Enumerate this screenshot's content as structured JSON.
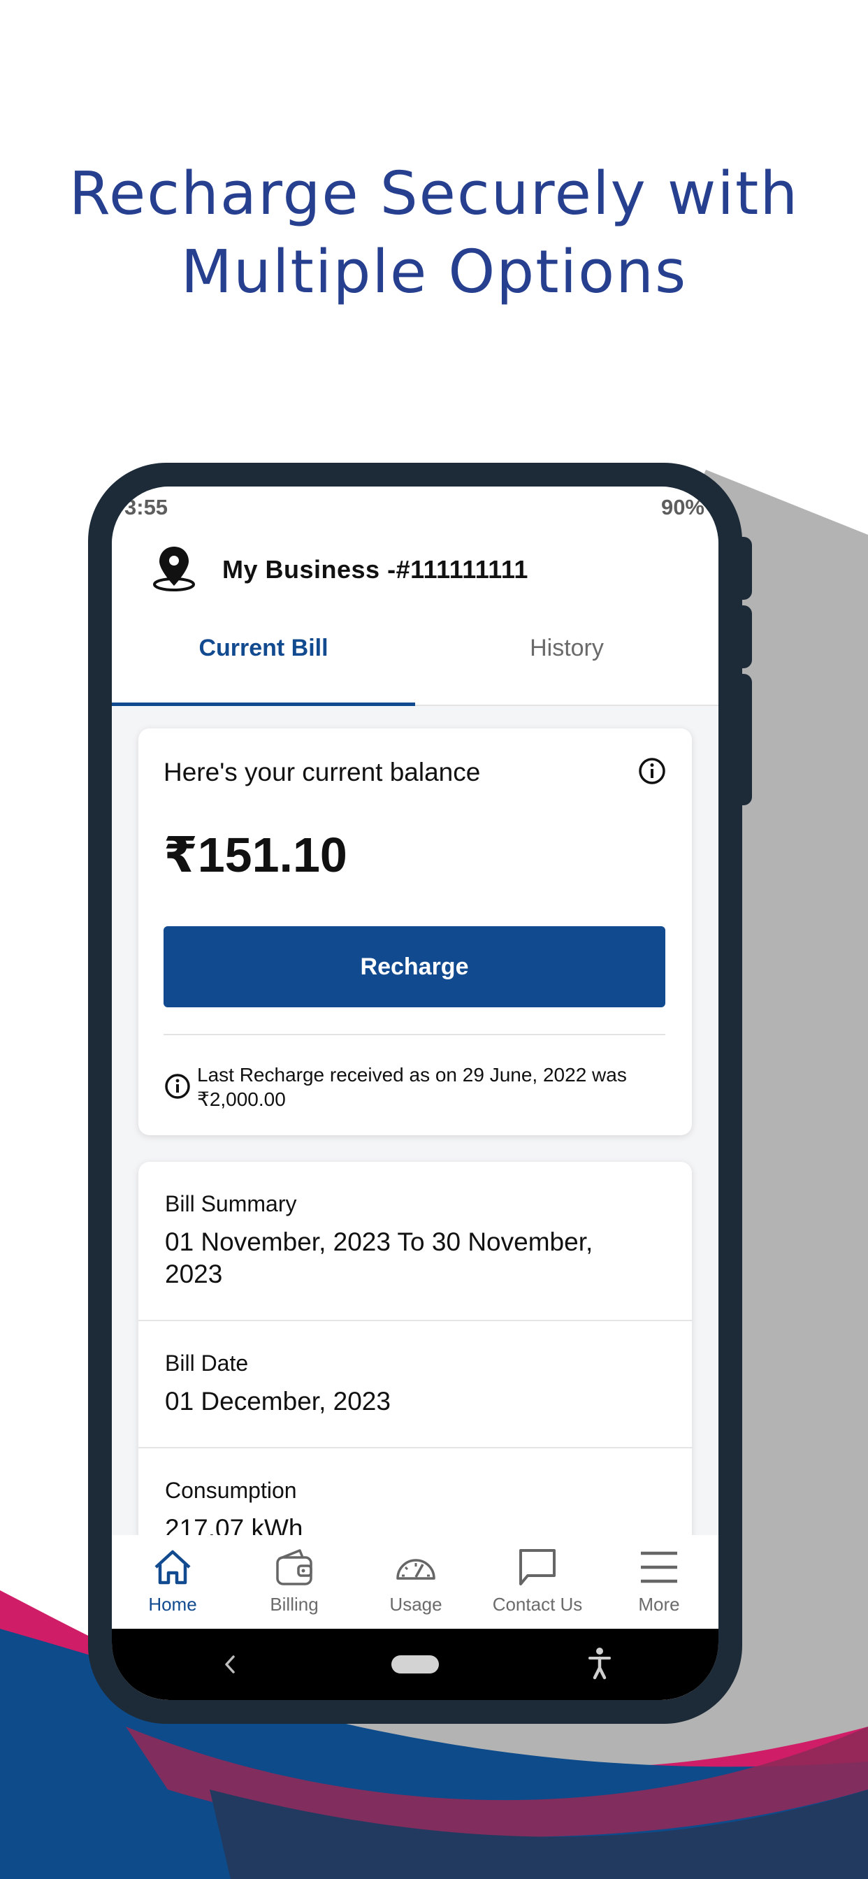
{
  "marketing": {
    "headline_line1": "Recharge Securely with",
    "headline_line2": "Multiple Options"
  },
  "status_bar": {
    "time": "3:55",
    "battery": "90%"
  },
  "header": {
    "account_title": "My Business -#111111111",
    "icon": "location-pin-icon"
  },
  "tabs": [
    {
      "label": "Current Bill",
      "active": true
    },
    {
      "label": "History",
      "active": false
    }
  ],
  "balance_card": {
    "label": "Here's your current balance",
    "amount": "₹151.10",
    "recharge_label": "Recharge",
    "last_recharge": "Last Recharge received as on 29 June, 2022 was ₹2,000.00"
  },
  "summary": {
    "rows": [
      {
        "label": "Bill Summary",
        "value": "01 November, 2023 To 30 November, 2023"
      },
      {
        "label": "Bill Date",
        "value": "01 December, 2023"
      },
      {
        "label": "Consumption",
        "value": "217.07 kWh"
      }
    ]
  },
  "bottom_nav": {
    "items": [
      {
        "label": "Home",
        "icon": "home-icon",
        "active": true
      },
      {
        "label": "Billing",
        "icon": "wallet-icon",
        "active": false
      },
      {
        "label": "Usage",
        "icon": "speedometer-icon",
        "active": false
      },
      {
        "label": "Contact Us",
        "icon": "chat-bubble-icon",
        "active": false
      },
      {
        "label": "More",
        "icon": "menu-icon",
        "active": false
      }
    ]
  },
  "colors": {
    "brand_blue": "#124a8f",
    "headline_blue": "#263f8f",
    "phone_frame": "#1d2b38",
    "wave_navy": "#0d4b8b",
    "wave_magenta": "#cf1d67",
    "shadow_gray": "#b3b3b3"
  }
}
